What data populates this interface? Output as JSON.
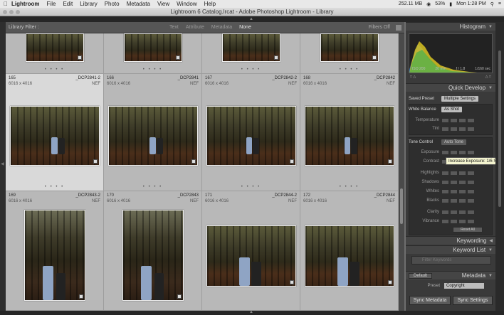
{
  "menubar": {
    "app": "Lightroom",
    "items": [
      "File",
      "Edit",
      "Library",
      "Photo",
      "Metadata",
      "View",
      "Window",
      "Help"
    ],
    "memory": "252.11 MB",
    "battery": "53%",
    "clock": "Mon 1:28 PM"
  },
  "window": {
    "title": "Lightroom 6 Catalog.lrcat - Adobe Photoshop Lightroom - Library"
  },
  "filterbar": {
    "label": "Library Filter :",
    "options": [
      "Text",
      "Attribute",
      "Metadata",
      "None"
    ],
    "lock": "Filters Off"
  },
  "grid": {
    "row2": [
      {
        "num": "165",
        "dim": "6016 x 4016",
        "fname": "_DCP2841-2",
        "ext": "NEF"
      },
      {
        "num": "166",
        "dim": "6016 x 4016",
        "fname": "_DCP2841",
        "ext": "NEF"
      },
      {
        "num": "167",
        "dim": "6016 x 4016",
        "fname": "_DCP2842-2",
        "ext": "NEF"
      },
      {
        "num": "168",
        "dim": "6016 x 4016",
        "fname": "_DCP2842",
        "ext": "NEF"
      }
    ],
    "row3": [
      {
        "num": "169",
        "dim": "6016 x 4016",
        "fname": "_DCP2843-2",
        "ext": "NEF"
      },
      {
        "num": "170",
        "dim": "6016 x 4016",
        "fname": "_DCP2843",
        "ext": "NEF"
      },
      {
        "num": "171",
        "dim": "6016 x 4016",
        "fname": "_DCP2844-2",
        "ext": "NEF"
      },
      {
        "num": "172",
        "dim": "6016 x 4016",
        "fname": "_DCP2844",
        "ext": "NEF"
      }
    ],
    "dots": "• • • •"
  },
  "panel": {
    "histogram": "Histogram",
    "histo_info": {
      "iso": "ISO 200",
      "focal": "20 mm",
      "fstop": "f / 1.8",
      "shutter": "1/160 sec"
    },
    "histo_flags": {
      "left": "□ △",
      "right": "△ □"
    },
    "quick_develop": "Quick Develop",
    "saved_preset_label": "Saved Preset",
    "saved_preset_value": "Multiple Settings",
    "white_balance_label": "White Balance",
    "white_balance_value": "As Shot",
    "temperature": "Temperature",
    "tint": "Tint",
    "tone_control": "Tone Control",
    "auto_tone": "Auto Tone",
    "tone_rows": [
      "Exposure",
      "Contrast",
      "Highlights",
      "Shadows",
      "Whites",
      "Blacks",
      "Clarity",
      "Vibrance"
    ],
    "reset_all": "Reset All",
    "tooltip": "Increase Exposure: 1/6 Stop",
    "keywording": "Keywording",
    "keyword_list": "Keyword List",
    "keyword_placeholder": "Filter Keywords",
    "metadata": "Metadata",
    "default": "Default",
    "preset_label": "Preset",
    "preset_value": "Copyright",
    "sync_metadata": "Sync Metadata",
    "sync_settings": "Sync Settings"
  }
}
